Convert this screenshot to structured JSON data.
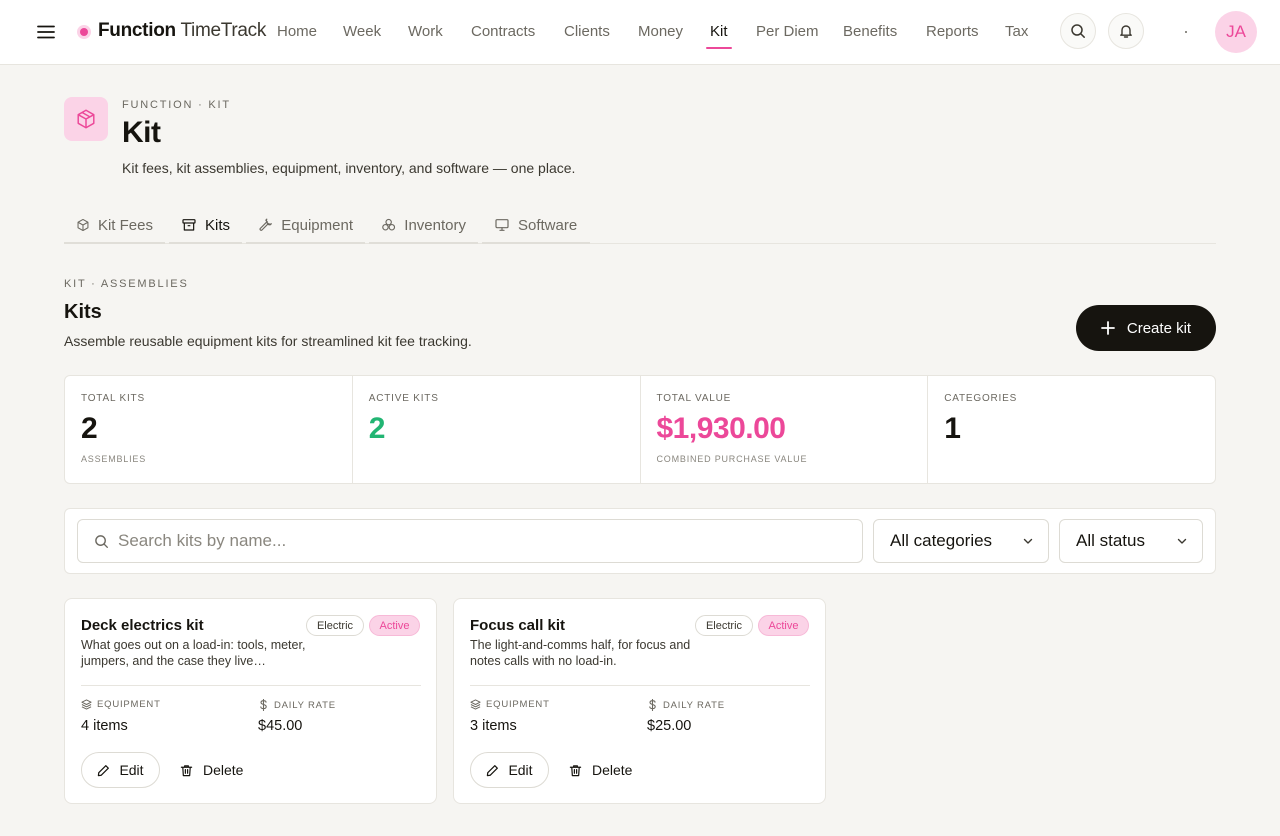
{
  "colors": {
    "accent": "#ec4899",
    "accent_soft": "#fbd3e7",
    "success": "#22b573",
    "ink": "#16140f",
    "muted": "#6c6961",
    "page_bg": "#f6f5f2"
  },
  "topbar": {
    "brand_bold": "Function",
    "brand_light": "TimeTrack",
    "nav": [
      "Home",
      "Week",
      "Work",
      "Contracts",
      "Clients",
      "Money",
      "Kit",
      "Per Diem",
      "Benefits",
      "Reports",
      "Tax"
    ],
    "active_nav": "Kit",
    "avatar_initials": "JA",
    "icons": [
      "menu-icon",
      "search-icon",
      "bell-icon"
    ]
  },
  "page": {
    "eyebrow": "FUNCTION · KIT",
    "title": "Kit",
    "subtitle": "Kit fees, kit assemblies, equipment, inventory, and software — one place.",
    "icon": "package-icon"
  },
  "tabs": [
    {
      "label": "Kit Fees",
      "icon": "package-icon"
    },
    {
      "label": "Kits",
      "icon": "archive-icon",
      "active": true
    },
    {
      "label": "Equipment",
      "icon": "wrench-icon"
    },
    {
      "label": "Inventory",
      "icon": "boxes-icon"
    },
    {
      "label": "Software",
      "icon": "monitor-icon"
    }
  ],
  "section": {
    "eyebrow": "KIT · ASSEMBLIES",
    "title": "Kits",
    "subtitle": "Assemble reusable equipment kits for streamlined kit fee tracking.",
    "create_label": "Create kit"
  },
  "stats": [
    {
      "label": "TOTAL KITS",
      "value": "2",
      "note": "ASSEMBLIES"
    },
    {
      "label": "ACTIVE KITS",
      "value": "2",
      "note": ""
    },
    {
      "label": "TOTAL VALUE",
      "value": "$1,930.00",
      "note": "COMBINED PURCHASE VALUE"
    },
    {
      "label": "CATEGORIES",
      "value": "1",
      "note": ""
    }
  ],
  "filters": {
    "search_placeholder": "Search kits by name...",
    "category_value": "All categories",
    "status_value": "All status"
  },
  "kits": [
    {
      "name": "Deck electrics kit",
      "description": "What goes out on a load-in: tools, meter, jumpers, and the case they live…",
      "category": "Electric",
      "status": "Active",
      "equipment_label": "EQUIPMENT",
      "equipment_value": "4 items",
      "rate_label": "DAILY RATE",
      "rate_value": "$45.00",
      "edit_label": "Edit",
      "delete_label": "Delete"
    },
    {
      "name": "Focus call kit",
      "description": "The light-and-comms half, for focus and notes calls with no load-in.",
      "category": "Electric",
      "status": "Active",
      "equipment_label": "EQUIPMENT",
      "equipment_value": "3 items",
      "rate_label": "DAILY RATE",
      "rate_value": "$25.00",
      "edit_label": "Edit",
      "delete_label": "Delete"
    }
  ]
}
